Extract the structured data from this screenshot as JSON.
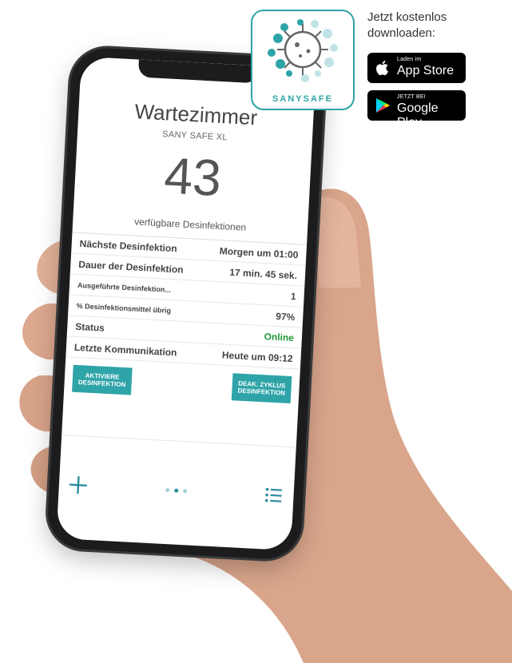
{
  "download": {
    "title": "Jetzt kostenlos downloaden:"
  },
  "stores": {
    "apple": {
      "small": "Laden im",
      "big": "App Store"
    },
    "google": {
      "small": "JETZT BEI",
      "big": "Google Play"
    }
  },
  "logo": {
    "text": "SANYSAFE"
  },
  "app": {
    "room_title": "Wartezimmer",
    "device_name": "SANY SAFE XL",
    "available_count": "43",
    "available_label": "verfügbare Desinfektionen",
    "info_rows": [
      {
        "label": "Nächste Desinfektion",
        "value": "Morgen um 01:00"
      },
      {
        "label": "Dauer der Desinfektion",
        "value": "17 min. 45 sek."
      },
      {
        "label": "Ausgeführte Desinfektion...",
        "value": "1"
      },
      {
        "label": "% Desinfektionsmittel übrig",
        "value": "97%"
      },
      {
        "label": "Status",
        "value": "Online"
      },
      {
        "label": "Letzte Kommunikation",
        "value": "Heute um 09:12"
      }
    ],
    "buttons": {
      "activate": "AKTIVIERE DESINFEKTION",
      "deactivate": "DEAK. ZYKLUS DESINFEKTION"
    }
  },
  "colors": {
    "accent": "#2fa4a8",
    "status_online": "#1f9a3a",
    "nav_icons": "#2a8b9d"
  },
  "icons": {
    "add": "plus-icon",
    "list": "list-icon",
    "pager": "page-dots",
    "apple": "apple-icon",
    "google": "google-play-icon"
  }
}
